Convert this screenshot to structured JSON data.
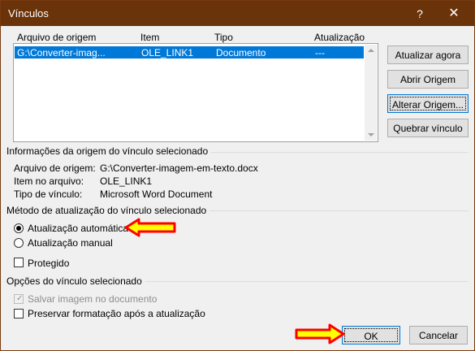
{
  "window": {
    "title": "Vínculos",
    "help_glyph": "?",
    "close_glyph": "✕"
  },
  "links_table": {
    "headers": [
      "Arquivo de origem",
      "Item",
      "Tipo",
      "Atualização"
    ],
    "rows": [
      {
        "source": "G:\\Converter-imag...",
        "item": "OLE_LINK1",
        "type": "Documento",
        "update": "---"
      }
    ]
  },
  "buttons": {
    "update_now": "Atualizar agora",
    "open_source": "Abrir Origem",
    "change_source": "Alterar Origem...",
    "break_link": "Quebrar vínculo",
    "ok": "OK",
    "cancel": "Cancelar"
  },
  "source_info": {
    "heading": "Informações da origem do vínculo selecionado",
    "source_file_label": "Arquivo de origem:",
    "source_file_value": "G:\\Converter-imagem-em-texto.docx",
    "item_label": "Item no arquivo:",
    "item_value": "OLE_LINK1",
    "link_type_label": "Tipo de vínculo:",
    "link_type_value": "Microsoft Word Document"
  },
  "update_method": {
    "heading": "Método de atualização do vínculo selecionado",
    "automatic": "Atualização automática",
    "manual": "Atualização manual",
    "locked": "Protegido",
    "selected": "automatic"
  },
  "link_options": {
    "heading": "Opções do vínculo selecionado",
    "save_picture": "Salvar imagem no documento",
    "preserve_formatting": "Preservar formatação após a atualização"
  },
  "colors": {
    "title_bar": "#6b3309",
    "selection": "#0078d7",
    "annotation_arrow": "#ff0000",
    "annotation_fill": "#ffff00"
  }
}
